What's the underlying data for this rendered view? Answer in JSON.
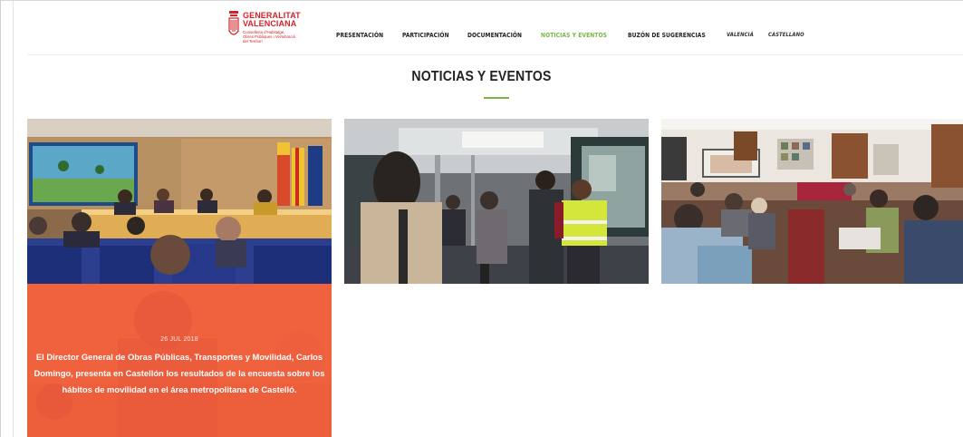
{
  "brand": {
    "title_line1": "GENERALITAT",
    "title_line2": "VALENCIANA",
    "subtitle_line1": "Conselleria d'Habitatge,",
    "subtitle_line2": "Obres Públiques i Vertebració",
    "subtitle_line3": "del Territori",
    "color": "#d2232a"
  },
  "nav": {
    "items": [
      {
        "label": "PRESENTACIÓN"
      },
      {
        "label": "PARTICIPACIÓN"
      },
      {
        "label": "DOCUMENTACIÓN"
      },
      {
        "label": "NOTICIAS Y EVENTOS",
        "active": true
      },
      {
        "label": "BUZÓN DE SUGERENCIAS"
      }
    ],
    "languages": [
      {
        "label": "VALENCIÀ"
      },
      {
        "label": "CASTELLANO"
      }
    ],
    "active_color": "#7ab648"
  },
  "section": {
    "title_bold": "NOTICIAS",
    "title_rest": " Y EVENTOS",
    "accent": "#7ab648"
  },
  "news": {
    "cards": [
      {
        "image": "meeting-room-presentation-photo"
      },
      {
        "image": "bus-interior-survey-photo"
      },
      {
        "image": "public-meeting-hall-photo"
      }
    ],
    "featured": {
      "date": "26 JUL 2018",
      "text": "El Director General de Obras Públicas, Transportes y Movilidad, Carlos Domingo, presenta en Castellón los resultados de la encuesta sobre los hábitos de movilidad en el área metropolitana de Castelló.",
      "overlay_color": "#f0623d"
    }
  }
}
